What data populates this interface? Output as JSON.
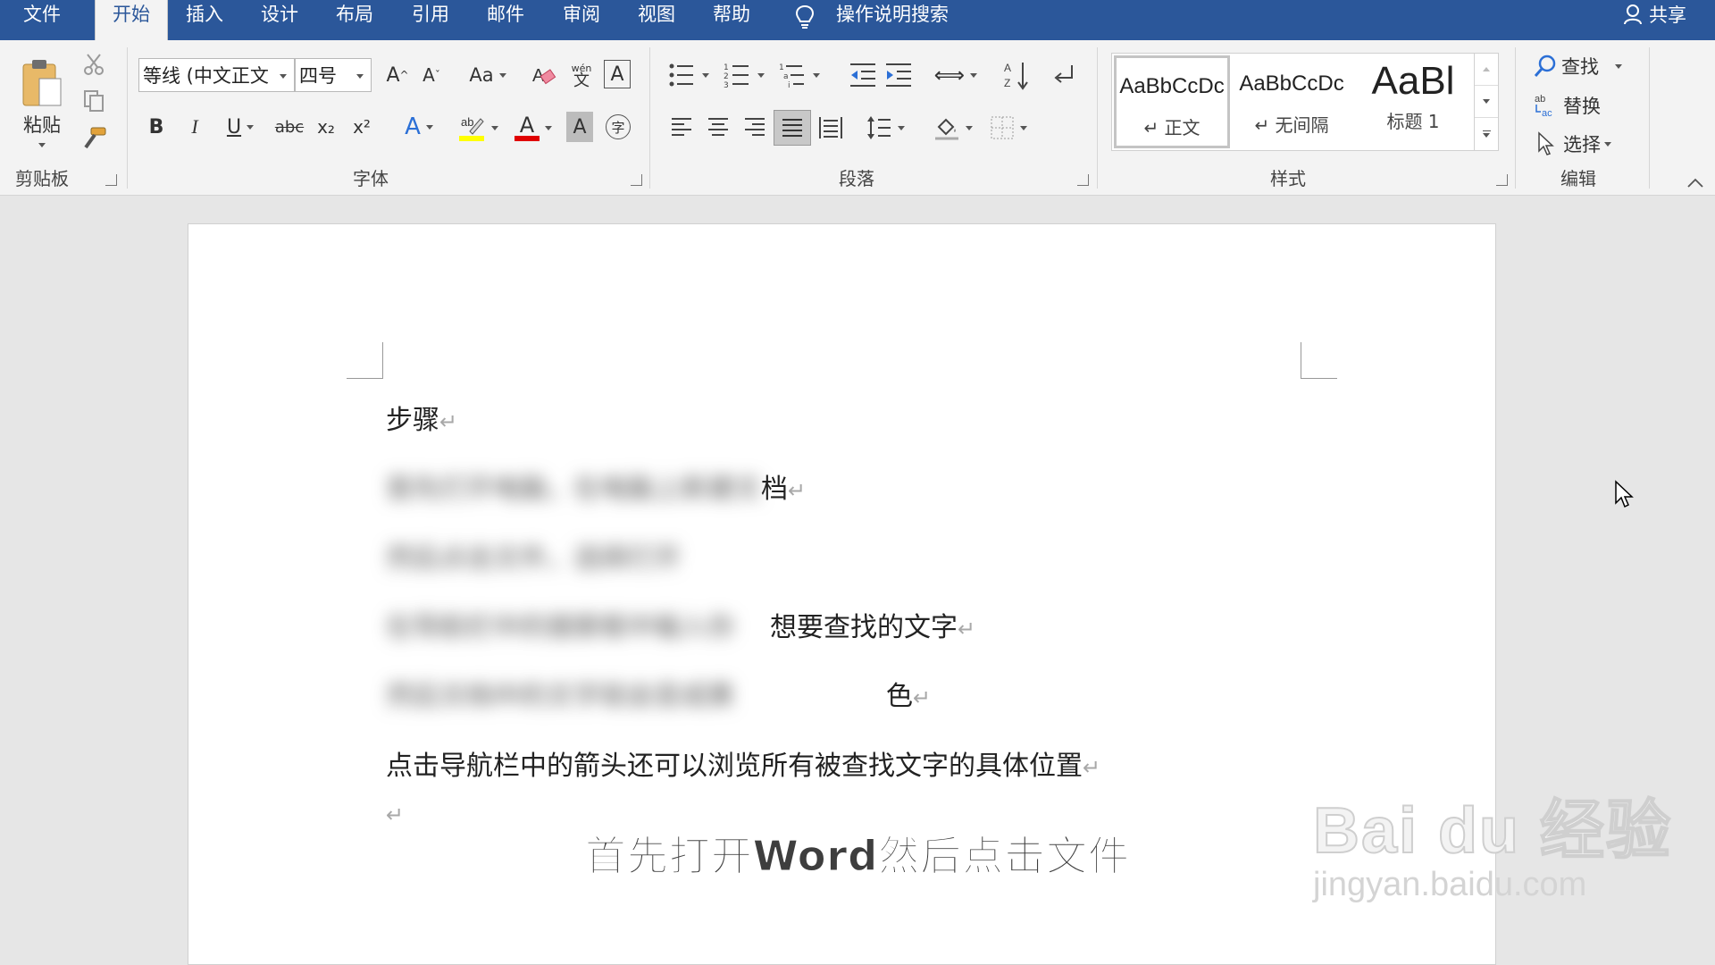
{
  "tabs": [
    "文件",
    "开始",
    "插入",
    "设计",
    "布局",
    "引用",
    "邮件",
    "审阅",
    "视图",
    "帮助"
  ],
  "active_tab": "开始",
  "tell_me": "操作说明搜索",
  "share": "共享",
  "clipboard": {
    "paste": "粘贴",
    "label": "剪贴板"
  },
  "font": {
    "name": "等线 (中文正文",
    "size": "四号",
    "label": "字体",
    "case_btn": "Aa",
    "bold": "B",
    "italic": "I",
    "underline": "U",
    "strike": "abc",
    "subscript": "x₂",
    "superscript": "x²",
    "phonetic": "文",
    "char_border": "A",
    "enclose": "字",
    "font_color": "A",
    "shading": "A",
    "effects": "A",
    "grow": "A",
    "shrink": "A"
  },
  "paragraph": {
    "label": "段落"
  },
  "styles": {
    "label": "样式",
    "items": [
      {
        "sample": "AaBbCcDc",
        "name": "↵ 正文"
      },
      {
        "sample": "AaBbCcDc",
        "name": "↵ 无间隔"
      },
      {
        "sample": "AaBl",
        "name": "标题 1"
      }
    ]
  },
  "editing": {
    "label": "编辑",
    "find": "查找",
    "replace": "替换",
    "select": "选择"
  },
  "colors": {
    "brand": "#2b579a",
    "ribbon": "#f3f3f3",
    "highlight": "#ffff00",
    "font_color": "#e00000"
  },
  "document": {
    "lines": [
      {
        "visible_text": "步骤",
        "blurred": ""
      },
      {
        "visible_text": "档",
        "blurred": "首先打开电脑，在电脑上新建文"
      },
      {
        "visible_text": "",
        "blurred": "然后点击文件，选择打开"
      },
      {
        "visible_text": "想要查找的文字",
        "blurred": "在导航栏中的搜索框中输入你"
      },
      {
        "visible_text": "色",
        "blurred": "然后文档中的文字就会变成黄"
      },
      {
        "visible_text": "点击导航栏中的箭头还可以浏览所有被查找文字的具体位置",
        "blurred": ""
      },
      {
        "visible_text": "",
        "blurred": ""
      }
    ],
    "paragraph_mark": "↵"
  },
  "subtitle": "首先打开Word然后点击文件",
  "watermark": {
    "brand": "Bai du 经验",
    "url": "jingyan.baidu.com"
  }
}
